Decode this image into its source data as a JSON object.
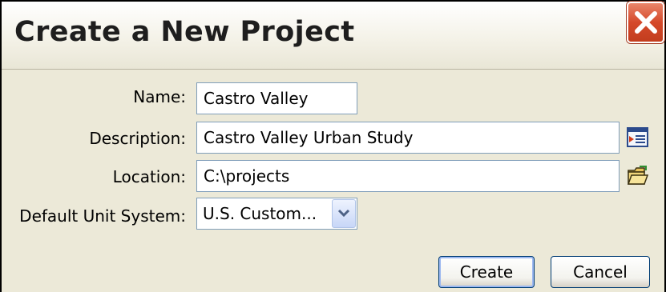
{
  "dialog": {
    "title": "Create a New Project",
    "close_icon": "close-x-icon"
  },
  "form": {
    "name_label": "Name:",
    "name_value": "Castro Valley",
    "description_label": "Description:",
    "description_value": "Castro Valley Urban Study",
    "description_icon": "edit-description-icon",
    "location_label": "Location:",
    "location_value": "C:\\projects",
    "location_icon": "folder-open-icon",
    "unit_label": "Default Unit System:",
    "unit_value": "U.S. Custom...",
    "unit_arrow_icon": "chevron-down-icon"
  },
  "buttons": {
    "create_label": "Create",
    "cancel_label": "Cancel"
  },
  "colors": {
    "close_red": "#d5492a",
    "field_border": "#7f9db9",
    "dialog_bg": "#ece9d8"
  }
}
